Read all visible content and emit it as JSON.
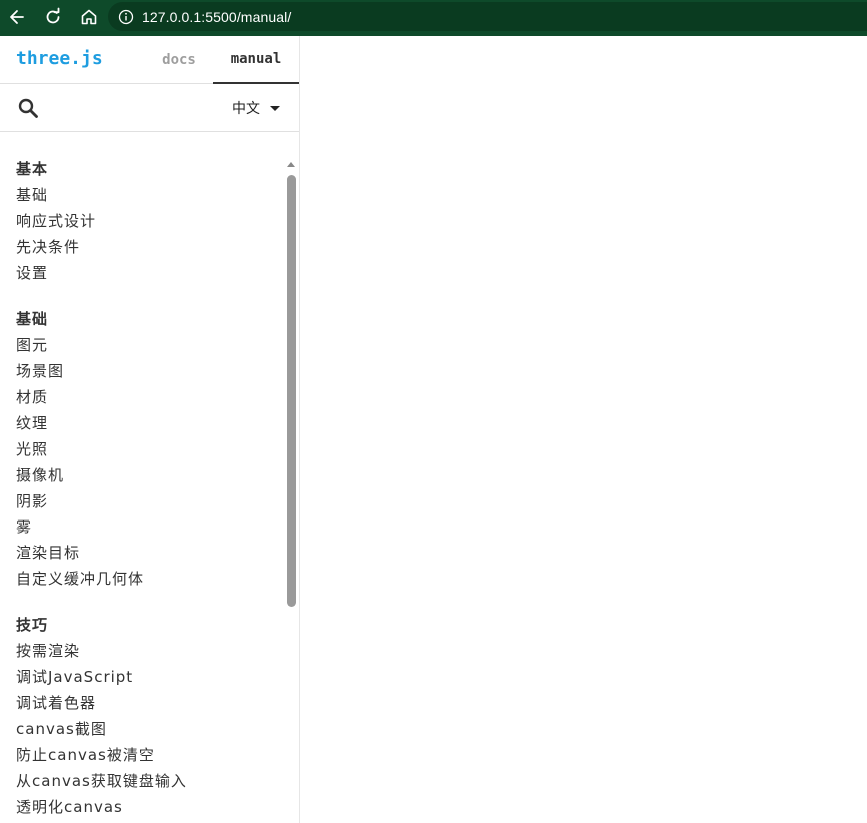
{
  "browser": {
    "url": "127.0.0.1:5500/manual/",
    "colors": {
      "toolbar": "#0e4a2a",
      "url_bar": "#0a3b20"
    }
  },
  "header": {
    "logo": "three.js",
    "tabs": [
      {
        "label": "docs",
        "active": false
      },
      {
        "label": "manual",
        "active": true
      }
    ]
  },
  "search": {
    "icon": "search-icon",
    "language": "中文"
  },
  "nav": {
    "groups": [
      {
        "title": "基本",
        "items": [
          "基础",
          "响应式设计",
          "先决条件",
          "设置"
        ]
      },
      {
        "title": "基础",
        "items": [
          "图元",
          "场景图",
          "材质",
          "纹理",
          "光照",
          "摄像机",
          "阴影",
          "雾",
          "渲染目标",
          "自定义缓冲几何体"
        ]
      },
      {
        "title": "技巧",
        "items": [
          "按需渲染",
          "调试JavaScript",
          "调试着色器",
          "canvas截图",
          "防止canvas被清空",
          "从canvas获取键盘输入",
          "透明化canvas"
        ]
      }
    ]
  },
  "colors": {
    "logo": "#1e9de0",
    "text": "#333333",
    "tab_inactive": "#9e9e9e"
  }
}
